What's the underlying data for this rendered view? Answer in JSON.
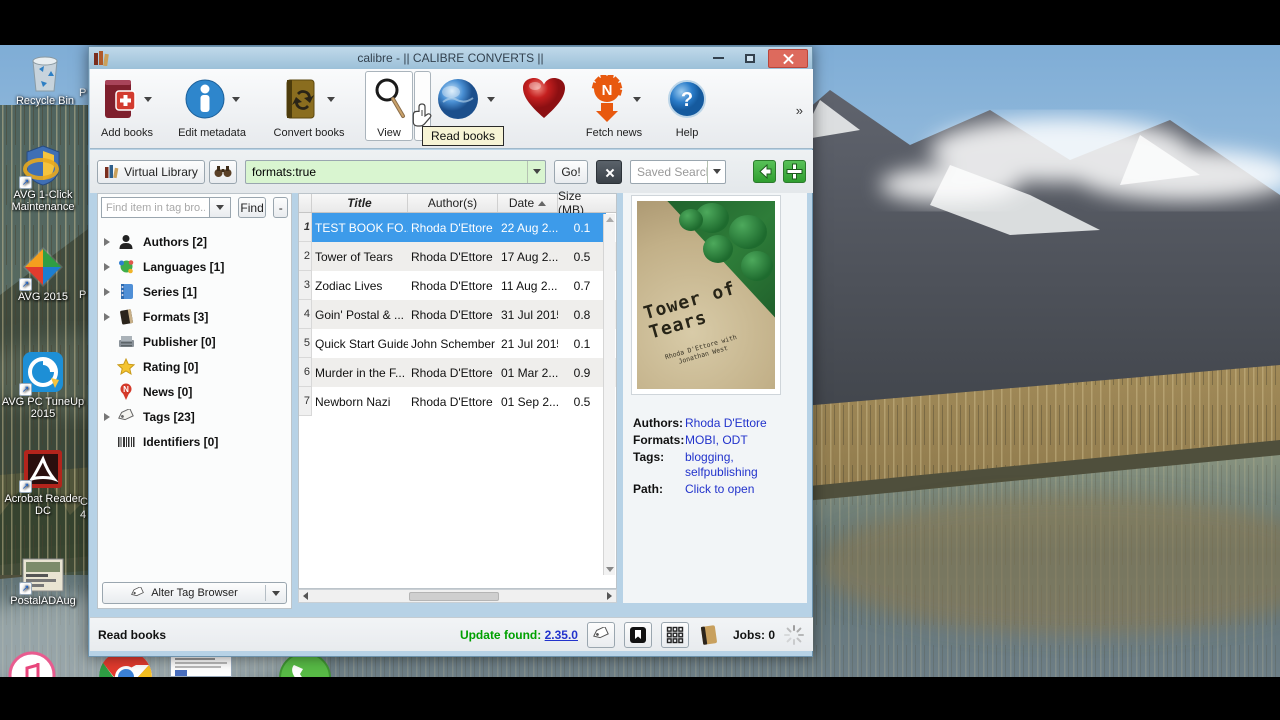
{
  "desktop": {
    "icons": [
      {
        "label": "Recycle Bin"
      },
      {
        "label": "AVG 1-Click Maintenance"
      },
      {
        "label": "AVG 2015"
      },
      {
        "label": "AVG PC TuneUp 2015"
      },
      {
        "label": "Acrobat Reader DC"
      },
      {
        "label": "PostalADAug"
      }
    ],
    "label_fragments": {
      "f1": "P",
      "f2": "P",
      "f3": "C",
      "f4": "4"
    }
  },
  "window": {
    "title": "calibre - || CALIBRE CONVERTS ||",
    "toolbar": {
      "add_books": "Add books",
      "edit_metadata": "Edit metadata",
      "convert_books": "Convert books",
      "view": "View",
      "fetch_news": "Fetch news",
      "help": "Help",
      "tooltip": "Read books",
      "overflow": "»"
    },
    "search": {
      "virtual_library": "Virtual Library",
      "value": "formats:true",
      "go": "Go!",
      "saved_searches": "Saved Searches"
    },
    "tag_browser": {
      "find_placeholder": "Find item in tag bro...",
      "find": "Find",
      "minus": "-",
      "items": [
        {
          "label": "Authors [2]"
        },
        {
          "label": "Languages [1]"
        },
        {
          "label": "Series [1]"
        },
        {
          "label": "Formats [3]"
        },
        {
          "label": "Publisher [0]"
        },
        {
          "label": "Rating [0]"
        },
        {
          "label": "News [0]"
        },
        {
          "label": "Tags [23]"
        },
        {
          "label": "Identifiers [0]"
        }
      ],
      "alter": "Alter Tag Browser"
    },
    "book_list": {
      "headers": {
        "title": "Title",
        "authors": "Author(s)",
        "date": "Date",
        "size": "Size (MB)"
      },
      "rows": [
        {
          "num": "1",
          "title": "TEST BOOK FO...",
          "author": "Rhoda D'Ettore",
          "date": "22 Aug 2...",
          "size": "0.1"
        },
        {
          "num": "2",
          "title": "Tower of Tears",
          "author": "Rhoda D'Ettore",
          "date": "17 Aug 2...",
          "size": "0.5"
        },
        {
          "num": "3",
          "title": "Zodiac Lives",
          "author": "Rhoda D'Ettore",
          "date": "11 Aug 2...",
          "size": "0.7"
        },
        {
          "num": "4",
          "title": "Goin' Postal & ...",
          "author": "Rhoda D'Ettore",
          "date": "31 Jul 2015",
          "size": "0.8"
        },
        {
          "num": "5",
          "title": "Quick Start Guide",
          "author": "John Schember",
          "date": "21 Jul 2015",
          "size": "0.1"
        },
        {
          "num": "6",
          "title": "Murder in the F...",
          "author": "Rhoda D'Ettore",
          "date": "01 Mar 2...",
          "size": "0.9"
        },
        {
          "num": "7",
          "title": "Newborn Nazi",
          "author": "Rhoda D'Ettore",
          "date": "01 Sep 2...",
          "size": "0.5"
        }
      ]
    },
    "details": {
      "cover_title": "Tower of Tears",
      "cover_byline": "Rhoda D'Ettore with Jonathan West",
      "authors_label": "Authors:",
      "authors": "Rhoda D'Ettore",
      "formats_label": "Formats:",
      "formats": "MOBI, ODT",
      "tags_label": "Tags:",
      "tags_line1": "blogging,",
      "tags_line2": "selfpublishing",
      "path_label": "Path:",
      "path": "Click to open"
    },
    "status": {
      "mode": "Read books",
      "update_label": "Update found:",
      "update_version": "2.35.0",
      "jobs": "Jobs: 0"
    }
  }
}
